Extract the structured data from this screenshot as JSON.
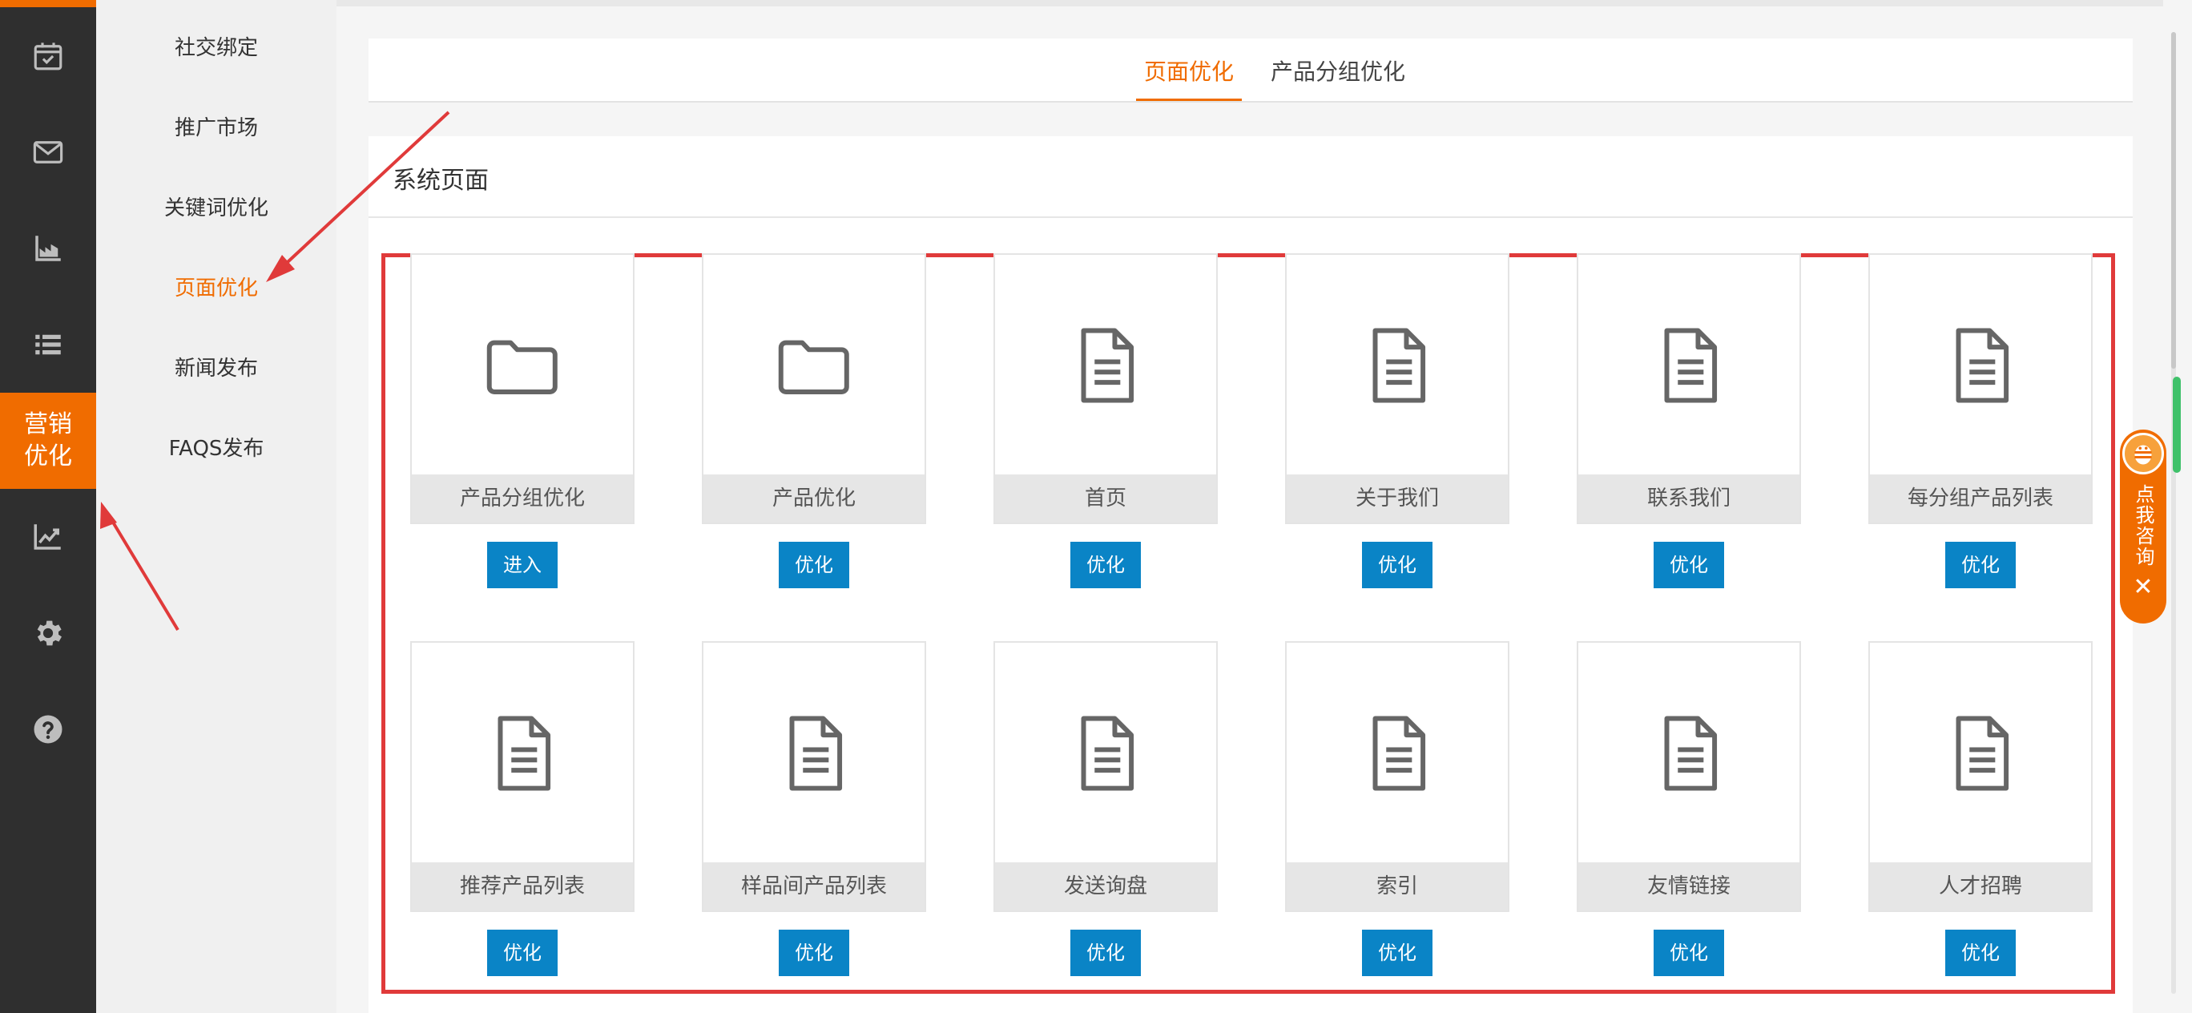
{
  "rail": {
    "items": [
      {
        "icon": "calendar-check-icon"
      },
      {
        "icon": "envelope-icon"
      },
      {
        "icon": "factory-chart-icon"
      },
      {
        "icon": "list-icon"
      },
      {
        "icon": "marketing-optimize",
        "label": "营销优化"
      },
      {
        "icon": "trend-chart-icon"
      },
      {
        "icon": "gear-icon"
      },
      {
        "icon": "question-icon"
      }
    ]
  },
  "submenu": {
    "items": [
      {
        "label": "社交绑定"
      },
      {
        "label": "推广市场"
      },
      {
        "label": "关键词优化"
      },
      {
        "label": "页面优化",
        "active": true
      },
      {
        "label": "新闻发布"
      },
      {
        "label": "FAQS发布"
      }
    ]
  },
  "tabs": [
    {
      "label": "页面优化",
      "active": true
    },
    {
      "label": "产品分组优化",
      "active": false
    }
  ],
  "section": {
    "title": "系统页面"
  },
  "cards": [
    {
      "label": "产品分组优化",
      "icon": "folder-icon",
      "button": "进入"
    },
    {
      "label": "产品优化",
      "icon": "folder-icon",
      "button": "优化"
    },
    {
      "label": "首页",
      "icon": "document-icon",
      "button": "优化"
    },
    {
      "label": "关于我们",
      "icon": "document-icon",
      "button": "优化"
    },
    {
      "label": "联系我们",
      "icon": "document-icon",
      "button": "优化"
    },
    {
      "label": "每分组产品列表",
      "icon": "document-icon",
      "button": "优化"
    },
    {
      "label": "推荐产品列表",
      "icon": "document-icon",
      "button": "优化"
    },
    {
      "label": "样品间产品列表",
      "icon": "document-icon",
      "button": "优化"
    },
    {
      "label": "发送询盘",
      "icon": "document-icon",
      "button": "优化"
    },
    {
      "label": "索引",
      "icon": "document-icon",
      "button": "优化"
    },
    {
      "label": "友情链接",
      "icon": "document-icon",
      "button": "优化"
    },
    {
      "label": "人才招聘",
      "icon": "document-icon",
      "button": "优化"
    }
  ],
  "consult": {
    "label": "点我咨询",
    "close": "✕"
  },
  "colors": {
    "accent": "#f06c00",
    "button": "#0a84c6",
    "highlight": "#e03a3a",
    "rail": "#2f2f2f"
  }
}
